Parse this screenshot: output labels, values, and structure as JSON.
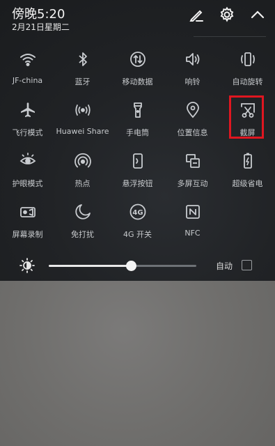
{
  "status": {
    "time": "傍晚5:20",
    "date": "2月21日星期二"
  },
  "header": {
    "actions": [
      "edit-icon",
      "gear-icon",
      "chevron-up-icon"
    ]
  },
  "tiles": [
    {
      "label": "JF-china",
      "icon": "wifi-icon"
    },
    {
      "label": "蓝牙",
      "icon": "bluetooth-icon"
    },
    {
      "label": "移动数据",
      "icon": "mobile-data-icon"
    },
    {
      "label": "响铃",
      "icon": "speaker-icon"
    },
    {
      "label": "自动旋转",
      "icon": "rotate-icon"
    },
    {
      "label": "飞行模式",
      "icon": "airplane-icon"
    },
    {
      "label": "Huawei Share",
      "icon": "share-signal-icon"
    },
    {
      "label": "手电筒",
      "icon": "flashlight-icon"
    },
    {
      "label": "位置信息",
      "icon": "location-icon"
    },
    {
      "label": "截屏",
      "icon": "screenshot-icon"
    },
    {
      "label": "护眼模式",
      "icon": "eye-icon"
    },
    {
      "label": "热点",
      "icon": "hotspot-icon"
    },
    {
      "label": "悬浮按钮",
      "icon": "floating-button-icon"
    },
    {
      "label": "多屏互动",
      "icon": "multiscreen-icon"
    },
    {
      "label": "超级省电",
      "icon": "battery-icon"
    },
    {
      "label": "屏幕录制",
      "icon": "record-icon"
    },
    {
      "label": "免打扰",
      "icon": "moon-icon"
    },
    {
      "label": "4G 开关",
      "icon": "4g-icon"
    },
    {
      "label": "NFC",
      "icon": "nfc-icon"
    }
  ],
  "brightness": {
    "level": 0.56,
    "auto_label": "自动"
  },
  "colors": {
    "highlight": "#e01620",
    "icon": "#c9ccd0"
  }
}
